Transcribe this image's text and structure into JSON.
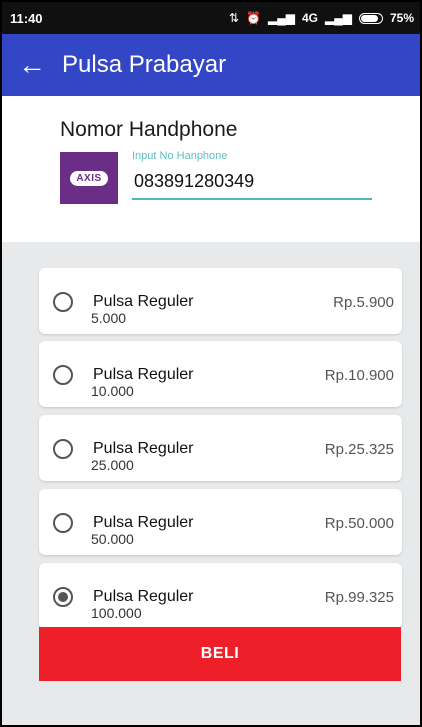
{
  "status_bar": {
    "time": "11:40",
    "network": "4G",
    "battery": "75%"
  },
  "app_bar": {
    "title": "Pulsa Prabayar"
  },
  "phone": {
    "label": "Nomor Handphone",
    "operator_logo": "AXIS",
    "input_hint": "Input No Hanphone",
    "input_value": "083891280349"
  },
  "products": [
    {
      "name": "Pulsa Reguler",
      "nominal": "5.000",
      "price": "Rp.5.900",
      "selected": false
    },
    {
      "name": "Pulsa Reguler",
      "nominal": "10.000",
      "price": "Rp.10.900",
      "selected": false
    },
    {
      "name": "Pulsa Reguler",
      "nominal": "25.000",
      "price": "Rp.25.325",
      "selected": false
    },
    {
      "name": "Pulsa Reguler",
      "nominal": "50.000",
      "price": "Rp.50.000",
      "selected": false
    },
    {
      "name": "Pulsa Reguler",
      "nominal": "100.000",
      "price": "Rp.99.325",
      "selected": true
    }
  ],
  "buy_button": {
    "label": "BELI"
  },
  "colors": {
    "app_bar": "#3346c6",
    "accent": "#4fb8bf",
    "buy_button": "#ee1f28",
    "axis_brand": "#6a2e87"
  }
}
